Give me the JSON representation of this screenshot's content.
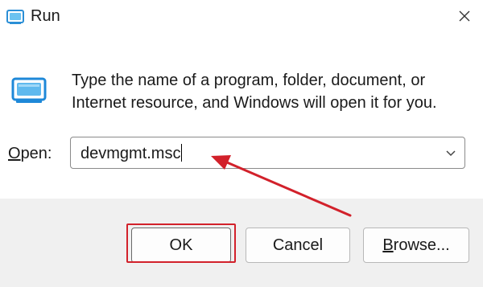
{
  "window": {
    "title": "Run",
    "close_icon": "close-icon",
    "app_icon": "run-icon"
  },
  "body": {
    "icon": "run-program-icon",
    "message": "Type the name of a program, folder, document, or Internet resource, and Windows will open it for you."
  },
  "open": {
    "label_mnemonic": "O",
    "label_rest": "pen:",
    "value": "devmgmt.msc",
    "dropdown_icon": "chevron-down-icon"
  },
  "buttons": {
    "ok": "OK",
    "cancel": "Cancel",
    "browse_mnemonic": "B",
    "browse_rest": "rowse..."
  },
  "annotation": {
    "color": "#d2212b"
  }
}
